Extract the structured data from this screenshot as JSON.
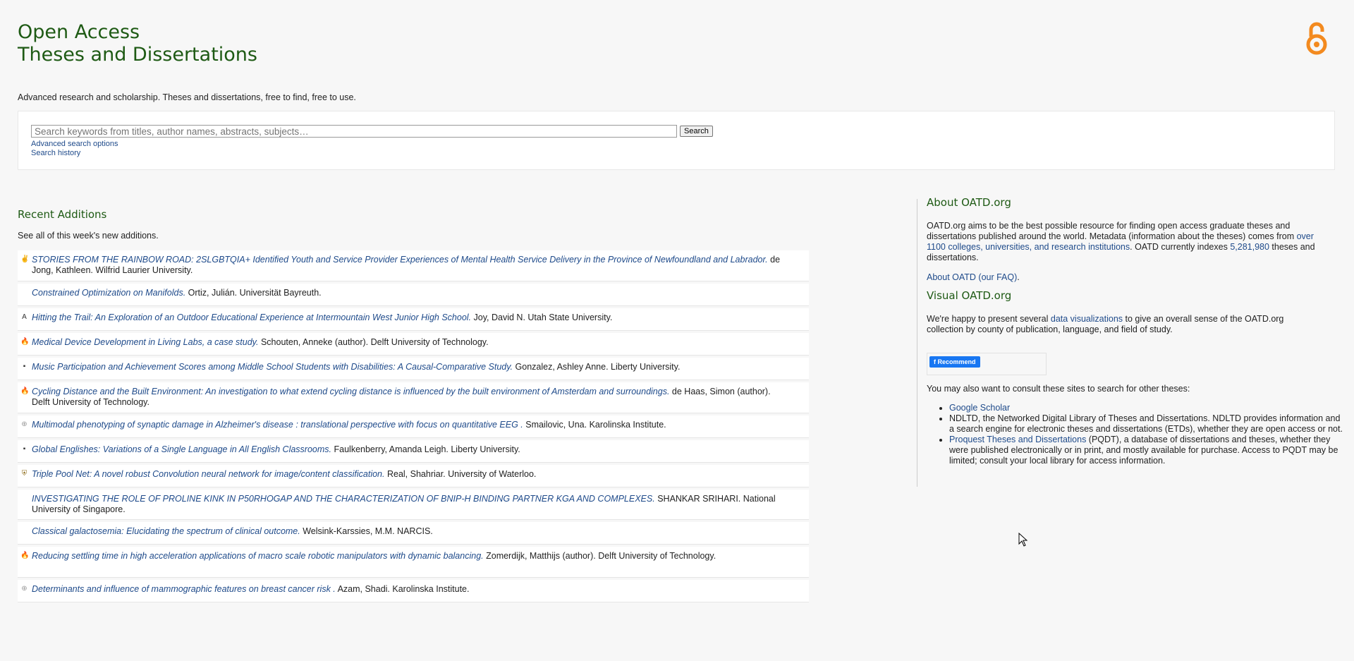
{
  "header": {
    "title_line1": "Open Access",
    "title_line2": "Theses and Dissertations",
    "tagline": "Advanced research and scholarship. Theses and dissertations, free to find, free to use.",
    "logo_icon": "open-access-lock-icon",
    "logo_color": "#f38a1f"
  },
  "search": {
    "placeholder": "Search keywords from titles, author names, abstracts, subjects…",
    "button_label": "Search",
    "advanced_link": "Advanced search options",
    "history_link": "Search history"
  },
  "recent": {
    "heading": "Recent Additions",
    "intro": "See all of this week's new additions.",
    "items": [
      {
        "icon": "wlu-icon",
        "icon_glyph": "✌",
        "title": "STORIES FROM THE RAINBOW ROAD: 2SLGBTQIA+ Identified Youth and Service Provider Experiences of Mental Health Service Delivery in the Province of Newfoundland and Labrador.",
        "authors": "de Jong, Kathleen.",
        "institution": "Wilfrid Laurier University."
      },
      {
        "icon": "",
        "icon_glyph": "",
        "title": "Constrained Optimization on Manifolds.",
        "authors": "Ortiz, Julián.",
        "institution": "Universität Bayreuth."
      },
      {
        "icon": "usu-icon",
        "icon_glyph": "A",
        "title": "Hitting the Trail: An Exploration of an Outdoor Educational Experience at Intermountain West Junior High School.",
        "authors": "Joy, David N.",
        "institution": "Utah State University."
      },
      {
        "icon": "tu-delft-flame-icon",
        "icon_glyph": "🔥",
        "title": "Medical Device Development in Living Labs, a case study.",
        "authors": "Schouten, Anneke (author).",
        "institution": "Delft University of Technology."
      },
      {
        "icon": "liberty-icon",
        "icon_glyph": "▪",
        "title": "Music Participation and Achievement Scores among Middle School Students with Disabilities: A Causal-Comparative Study.",
        "authors": "Gonzalez, Ashley Anne.",
        "institution": "Liberty University."
      },
      {
        "icon": "tu-delft-flame-icon",
        "icon_glyph": "🔥",
        "title": "Cycling Distance and the Built Environment: An investigation to what extend cycling distance is influenced by the built environment of Amsterdam and surroundings.",
        "authors": "de Haas, Simon (author).",
        "institution": "Delft University of Technology."
      },
      {
        "icon": "karolinska-icon",
        "icon_glyph": "⊕",
        "title": "Multimodal phenotyping of synaptic damage in Alzheimer's disease : translational perspective with focus on quantitative EEG .",
        "authors": "Smailovic, Una.",
        "institution": "Karolinska Institute."
      },
      {
        "icon": "liberty-icon",
        "icon_glyph": "▪",
        "title": "Global Englishes: Variations of a Single Language in All English Classrooms.",
        "authors": "Faulkenberry, Amanda Leigh.",
        "institution": "Liberty University."
      },
      {
        "icon": "waterloo-icon",
        "icon_glyph": "⛨",
        "title": "Triple Pool Net: A novel robust Convolution neural network for image/content classification.",
        "authors": "Real, Shahriar.",
        "institution": "University of Waterloo."
      },
      {
        "icon": "",
        "icon_glyph": "",
        "title": "INVESTIGATING THE ROLE OF PROLINE KINK IN P50RHOGAP AND THE CHARACTERIZATION OF BNIP-H BINDING PARTNER KGA AND COMPLEXES.",
        "authors": "SHANKAR SRIHARI.",
        "institution": "National University of Singapore."
      },
      {
        "icon": "",
        "icon_glyph": "",
        "title": "Classical galactosemia: Elucidating the spectrum of clinical outcome.",
        "authors": "Welsink-Karssies, M.M.",
        "institution": "NARCIS."
      },
      {
        "icon": "tu-delft-flame-icon",
        "icon_glyph": "🔥",
        "title": "Reducing settling time in high acceleration applications of macro scale robotic manipulators with dynamic balancing.",
        "authors": "Zomerdijk, Matthijs (author).",
        "institution": "Delft University of Technology."
      },
      {
        "icon": "karolinska-icon",
        "icon_glyph": "⊕",
        "title": "Determinants and influence of mammographic features on breast cancer risk .",
        "authors": "Azam, Shadi.",
        "institution": "Karolinska Institute."
      }
    ]
  },
  "sidebar": {
    "about_heading": "About OATD.org",
    "about_text_1": "OATD.org aims to be the best possible resource for finding open access graduate theses and dissertations published around the world. Metadata (information about the theses) comes from ",
    "about_link": "over 1100 colleges, universities, and research institutions",
    "about_text_2": ". OATD currently indexes ",
    "about_count": "5,281,980",
    "about_text_3": " theses and dissertations.",
    "faq_link": "About OATD (our FAQ)",
    "faq_suffix": ".",
    "visual_heading": "Visual OATD.org",
    "visual_text_1": "We're happy to present several ",
    "visual_link": "data visualizations",
    "visual_text_2": " to give an overall sense of the OATD.org collection by county of publication, language, and field of study.",
    "fb_button": "Recommend",
    "consult_text": "You may also want to consult these sites to search for other theses:",
    "links": [
      {
        "link": "Google Scholar",
        "text": ""
      },
      {
        "link": "",
        "text": "NDLTD, the Networked Digital Library of Theses and Dissertations. NDLTD provides information and a search engine for electronic theses and dissertations (ETDs), whether they are open access or not."
      },
      {
        "link": "Proquest Theses and Dissertations",
        "text": " (PQDT), a database of dissertations and theses, whether they were published electronically or in print, and mostly available for purchase. Access to PQDT may be limited; consult your local library for access information."
      }
    ]
  },
  "colors": {
    "heading_green": "#1e5a14",
    "link_blue": "#1e4a8a",
    "background": "#f7f7f7"
  }
}
